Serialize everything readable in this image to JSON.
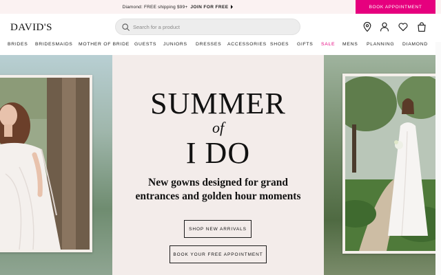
{
  "promo": {
    "text": "Diamond: FREE shipping $99+",
    "cta": "JOIN FOR FREE",
    "book_appointment": "BOOK APPOINTMENT"
  },
  "header": {
    "logo": "DAVID'S",
    "search_placeholder": "Search for a product",
    "icons": [
      "location-pin-icon",
      "account-icon",
      "heart-icon",
      "bag-icon"
    ]
  },
  "nav": {
    "items": [
      "BRIDES",
      "BRIDESMAIDS",
      "MOTHER OF BRIDE",
      "GUESTS",
      "JUNIORS",
      "DRESSES",
      "ACCESSORIES",
      "SHOES",
      "GIFTS",
      "SALE",
      "MENS",
      "PLANNING",
      "DIAMOND"
    ]
  },
  "hero": {
    "title_line1": "SUMMER",
    "title_of": "of",
    "title_line2": "I DO",
    "subtitle_line1": "New gowns designed for grand",
    "subtitle_line2": "entrances and golden hour moments",
    "primary_cta": "SHOP NEW ARRIVALS",
    "secondary_cta": "BOOK YOUR FREE APPOINTMENT"
  },
  "colors": {
    "accent": "#e6007e",
    "promo_bg": "#fbf2f2",
    "hero_bg": "#f3ecea"
  }
}
